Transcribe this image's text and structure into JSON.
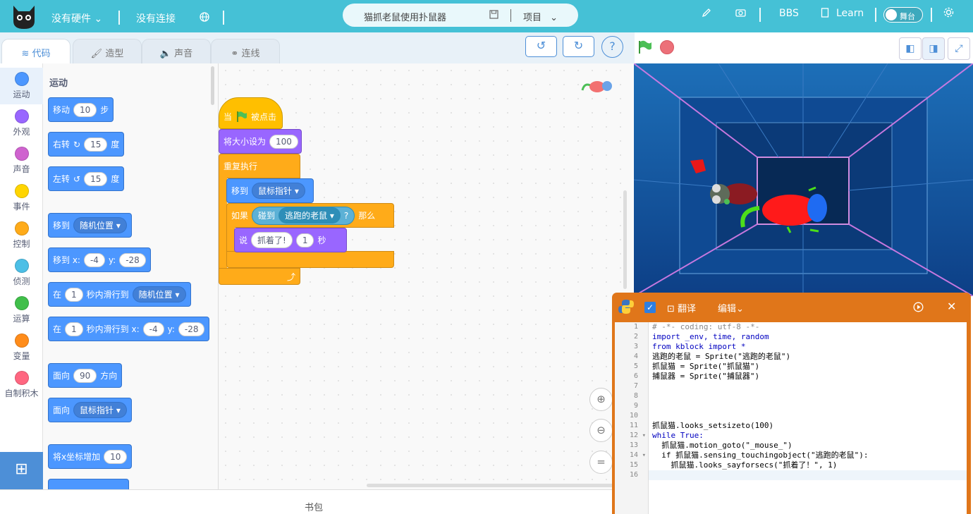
{
  "topbar": {
    "hardware": "没有硬件",
    "connection": "没有连接",
    "project_name": "猫抓老鼠使用扑鼠器",
    "project_menu": "项目",
    "bbs": "BBS",
    "learn": "Learn",
    "stage_toggle": "舞台"
  },
  "tabs": [
    {
      "label": "代码"
    },
    {
      "label": "造型"
    },
    {
      "label": "声音"
    },
    {
      "label": "连线"
    }
  ],
  "categories": [
    {
      "label": "运动",
      "color": "#4c97ff"
    },
    {
      "label": "外观",
      "color": "#9966ff"
    },
    {
      "label": "声音",
      "color": "#cf63cf"
    },
    {
      "label": "事件",
      "color": "#ffd500"
    },
    {
      "label": "控制",
      "color": "#ffab19"
    },
    {
      "label": "侦测",
      "color": "#4cbfe6"
    },
    {
      "label": "运算",
      "color": "#40bf4a"
    },
    {
      "label": "变量",
      "color": "#ff8c1a"
    },
    {
      "label": "自制积木",
      "color": "#ff6680"
    }
  ],
  "palette": {
    "title": "运动",
    "move": {
      "label": "移动",
      "value": "10",
      "unit": "步"
    },
    "turn_right": {
      "label": "右转",
      "value": "15",
      "unit": "度"
    },
    "turn_left": {
      "label": "左转",
      "value": "15",
      "unit": "度"
    },
    "goto": {
      "label": "移到",
      "target": "随机位置"
    },
    "goto_xy": {
      "label": "移到 x:",
      "x": "-4",
      "ylabel": "y:",
      "y": "-28"
    },
    "glide": {
      "label": "在",
      "secs": "1",
      "mid": "秒内滑行到",
      "target": "随机位置"
    },
    "glide_xy": {
      "label": "在",
      "secs": "1",
      "mid": "秒内滑行到 x:",
      "x": "-4",
      "ylabel": "y:",
      "y": "-28"
    },
    "point_dir": {
      "label": "面向",
      "value": "90",
      "unit": "方向"
    },
    "point_towards": {
      "label": "面向",
      "target": "鼠标指针"
    },
    "change_x": {
      "label": "将x坐标增加",
      "value": "10"
    }
  },
  "script": {
    "hat_when": "当",
    "hat_clicked": "被点击",
    "set_size_label": "将大小设为",
    "set_size_value": "100",
    "forever": "重复执行",
    "goto_label": "移到",
    "goto_target": "鼠标指针",
    "if_label": "如果",
    "touching_label": "碰到",
    "touching_target": "逃跑的老鼠",
    "touching_q": "?",
    "then": "那么",
    "say_label": "说",
    "say_text": "抓着了!",
    "say_secs": "1",
    "say_unit": "秒"
  },
  "bottom": {
    "backpack": "书包"
  },
  "python": {
    "translate": "翻译",
    "edit": "编辑",
    "line_numbers": [
      "1",
      "2",
      "3",
      "4",
      "5",
      "6",
      "7",
      "8",
      "9",
      "10",
      "11",
      "12",
      "13",
      "14",
      "15",
      "16"
    ],
    "lines": [
      "# -*- coding: utf-8 -*-",
      "import _env, time, random",
      "from kblock import *",
      "逃跑的老鼠 = Sprite(\"逃跑的老鼠\")",
      "抓鼠猫 = Sprite(\"抓鼠猫\")",
      "捕鼠器 = Sprite(\"捕鼠器\")",
      "",
      "",
      "",
      "",
      "抓鼠猫.looks_setsizeto(100)",
      "while True:",
      "  抓鼠猫.motion_goto(\"_mouse_\")",
      "  if 抓鼠猫.sensing_touchingobject(\"逃跑的老鼠\"):",
      "    抓鼠猫.looks_sayforsecs(\"抓着了！\", 1)",
      ""
    ]
  }
}
